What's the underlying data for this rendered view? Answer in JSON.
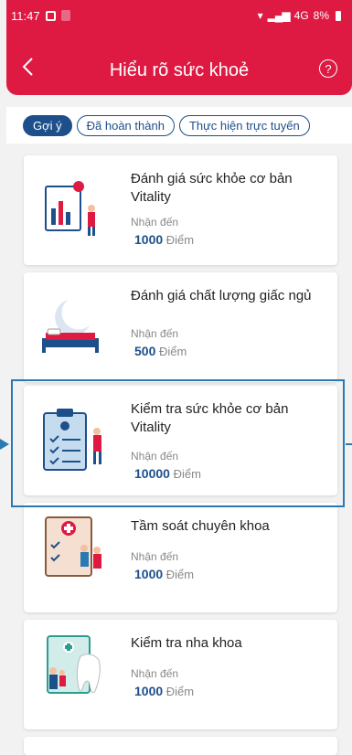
{
  "status": {
    "time": "11:47",
    "battery": "8%",
    "network": "4G"
  },
  "header": {
    "title": "Hiểu rõ sức khoẻ",
    "back": "<",
    "help": "?"
  },
  "tabs": [
    {
      "label": "Gợi ý",
      "active": true
    },
    {
      "label": "Đã hoàn thành",
      "active": false
    },
    {
      "label": "Thực hiện trực tuyến",
      "active": false
    }
  ],
  "cards": [
    {
      "title": "Đánh giá sức khỏe cơ bản Vitality",
      "earn": "Nhận đến",
      "points": "1000",
      "unit": "Điểm"
    },
    {
      "title": "Đánh giá chất lượng giấc ngủ",
      "earn": "Nhận đến",
      "points": "500",
      "unit": "Điểm"
    },
    {
      "title": "Kiểm tra sức khỏe cơ bản Vitality",
      "earn": "Nhận đến",
      "points": "10000",
      "unit": "Điểm"
    },
    {
      "title": "Tầm soát chuyên khoa",
      "earn": "Nhận đến",
      "points": "1000",
      "unit": "Điểm"
    },
    {
      "title": "Kiểm tra nha khoa",
      "earn": "Nhận đến",
      "points": "1000",
      "unit": "Điểm"
    }
  ],
  "colors": {
    "brand": "#de1a43",
    "accent": "#1d4f8b",
    "highlight": "#2a79b5"
  }
}
